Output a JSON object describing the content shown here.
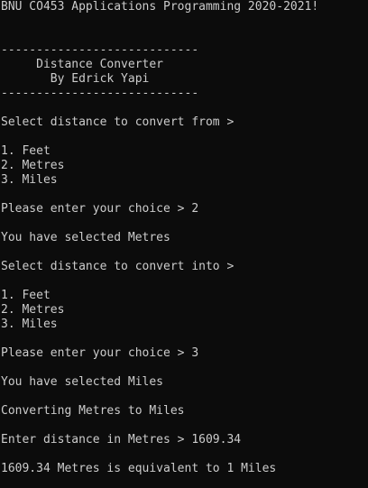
{
  "console": {
    "lines": {
      "header": "BNU CO453 Applications Programming 2020-2021!",
      "rule_top": "----------------------------",
      "title": "     Distance Converter",
      "author": "       By Edrick Yapi",
      "rule_bottom": "----------------------------",
      "prompt_from": "Select distance to convert from >",
      "from_option_1": "1. Feet",
      "from_option_2": "2. Metres",
      "from_option_3": "3. Miles",
      "from_choice_prompt": "Please enter your choice > 2",
      "from_selected": "You have selected Metres",
      "prompt_into": "Select distance to convert into >",
      "into_option_1": "1. Feet",
      "into_option_2": "2. Metres",
      "into_option_3": "3. Miles",
      "into_choice_prompt": "Please enter your choice > 3",
      "into_selected": "You have selected Miles",
      "converting": "Converting Metres to Miles",
      "enter_distance": "Enter distance in Metres > 1609.34",
      "result": "1609.34 Metres is equivalent to 1 Miles"
    }
  },
  "colors": {
    "background": "#0c0c0c",
    "text": "#cccccc",
    "accent": "#ff4c4c"
  }
}
